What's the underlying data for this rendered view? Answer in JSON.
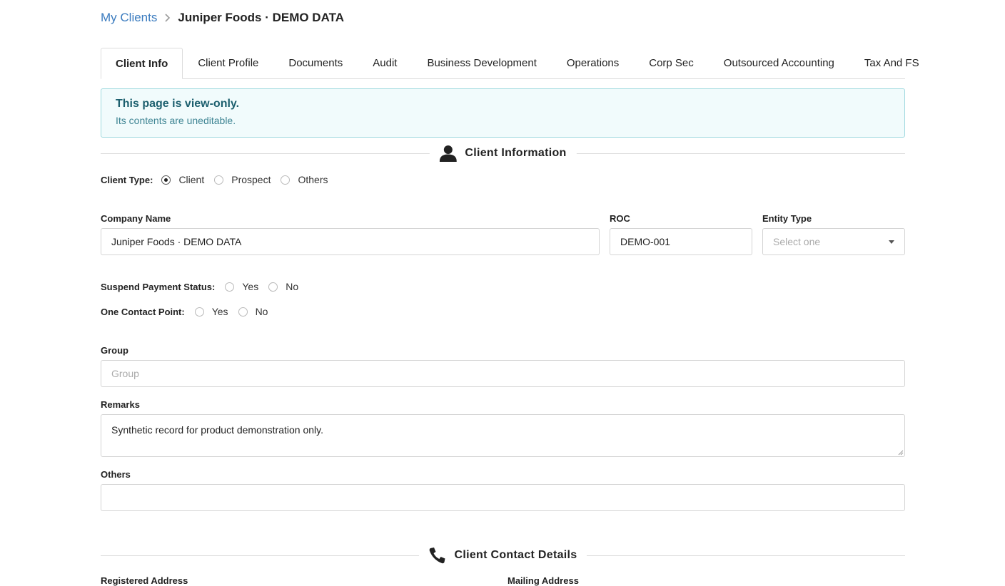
{
  "breadcrumb": {
    "parent": "My Clients",
    "current": "Juniper Foods · DEMO DATA"
  },
  "tabs": [
    {
      "label": "Client Info",
      "active": true
    },
    {
      "label": "Client Profile"
    },
    {
      "label": "Documents"
    },
    {
      "label": "Audit"
    },
    {
      "label": "Business Development"
    },
    {
      "label": "Operations"
    },
    {
      "label": "Corp Sec"
    },
    {
      "label": "Outsourced Accounting"
    },
    {
      "label": "Tax And FS"
    }
  ],
  "alert": {
    "title": "This page is view-only.",
    "text": "Its contents are uneditable."
  },
  "client_info": {
    "heading": "Client Information",
    "client_type": {
      "label": "Client Type:",
      "options": [
        "Client",
        "Prospect",
        "Others"
      ],
      "selected": "Client"
    },
    "company_name": {
      "label": "Company Name",
      "value": "Juniper Foods · DEMO DATA"
    },
    "roc": {
      "label": "ROC",
      "value": "DEMO-001"
    },
    "entity_type": {
      "label": "Entity Type",
      "placeholder": "Select one"
    },
    "suspend_payment": {
      "label": "Suspend Payment Status:",
      "options": [
        "Yes",
        "No"
      ]
    },
    "one_contact": {
      "label": "One Contact Point:",
      "options": [
        "Yes",
        "No"
      ]
    },
    "group": {
      "label": "Group",
      "placeholder": "Group"
    },
    "remarks": {
      "label": "Remarks",
      "value": "Synthetic record for product demonstration only."
    },
    "others": {
      "label": "Others",
      "value": ""
    }
  },
  "contact_details": {
    "heading": "Client Contact Details",
    "registered_address_label": "Registered Address",
    "mailing_address_label": "Mailing Address"
  },
  "colors": {
    "link": "#3a7bbf",
    "alert_bg": "#f1fbfc",
    "alert_border": "#9fd9df",
    "alert_title": "#1c5f6e"
  }
}
